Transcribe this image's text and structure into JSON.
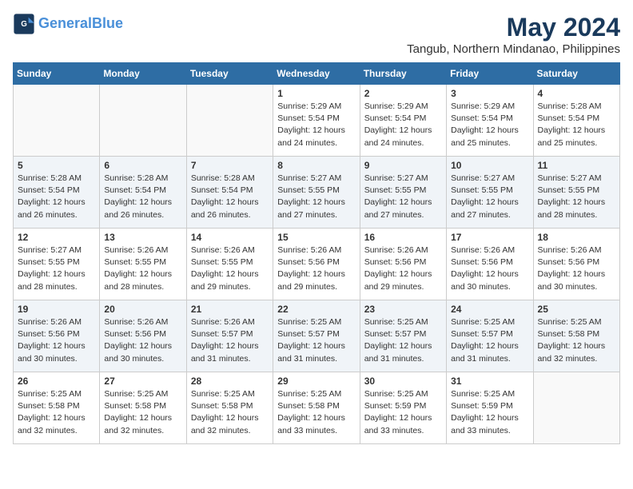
{
  "logo": {
    "line1": "General",
    "line2": "Blue"
  },
  "title": "May 2024",
  "subtitle": "Tangub, Northern Mindanao, Philippines",
  "days_of_week": [
    "Sunday",
    "Monday",
    "Tuesday",
    "Wednesday",
    "Thursday",
    "Friday",
    "Saturday"
  ],
  "weeks": [
    [
      {
        "day": "",
        "content": ""
      },
      {
        "day": "",
        "content": ""
      },
      {
        "day": "",
        "content": ""
      },
      {
        "day": "1",
        "content": "Sunrise: 5:29 AM\nSunset: 5:54 PM\nDaylight: 12 hours\nand 24 minutes."
      },
      {
        "day": "2",
        "content": "Sunrise: 5:29 AM\nSunset: 5:54 PM\nDaylight: 12 hours\nand 24 minutes."
      },
      {
        "day": "3",
        "content": "Sunrise: 5:29 AM\nSunset: 5:54 PM\nDaylight: 12 hours\nand 25 minutes."
      },
      {
        "day": "4",
        "content": "Sunrise: 5:28 AM\nSunset: 5:54 PM\nDaylight: 12 hours\nand 25 minutes."
      }
    ],
    [
      {
        "day": "5",
        "content": "Sunrise: 5:28 AM\nSunset: 5:54 PM\nDaylight: 12 hours\nand 26 minutes."
      },
      {
        "day": "6",
        "content": "Sunrise: 5:28 AM\nSunset: 5:54 PM\nDaylight: 12 hours\nand 26 minutes."
      },
      {
        "day": "7",
        "content": "Sunrise: 5:28 AM\nSunset: 5:54 PM\nDaylight: 12 hours\nand 26 minutes."
      },
      {
        "day": "8",
        "content": "Sunrise: 5:27 AM\nSunset: 5:55 PM\nDaylight: 12 hours\nand 27 minutes."
      },
      {
        "day": "9",
        "content": "Sunrise: 5:27 AM\nSunset: 5:55 PM\nDaylight: 12 hours\nand 27 minutes."
      },
      {
        "day": "10",
        "content": "Sunrise: 5:27 AM\nSunset: 5:55 PM\nDaylight: 12 hours\nand 27 minutes."
      },
      {
        "day": "11",
        "content": "Sunrise: 5:27 AM\nSunset: 5:55 PM\nDaylight: 12 hours\nand 28 minutes."
      }
    ],
    [
      {
        "day": "12",
        "content": "Sunrise: 5:27 AM\nSunset: 5:55 PM\nDaylight: 12 hours\nand 28 minutes."
      },
      {
        "day": "13",
        "content": "Sunrise: 5:26 AM\nSunset: 5:55 PM\nDaylight: 12 hours\nand 28 minutes."
      },
      {
        "day": "14",
        "content": "Sunrise: 5:26 AM\nSunset: 5:55 PM\nDaylight: 12 hours\nand 29 minutes."
      },
      {
        "day": "15",
        "content": "Sunrise: 5:26 AM\nSunset: 5:56 PM\nDaylight: 12 hours\nand 29 minutes."
      },
      {
        "day": "16",
        "content": "Sunrise: 5:26 AM\nSunset: 5:56 PM\nDaylight: 12 hours\nand 29 minutes."
      },
      {
        "day": "17",
        "content": "Sunrise: 5:26 AM\nSunset: 5:56 PM\nDaylight: 12 hours\nand 30 minutes."
      },
      {
        "day": "18",
        "content": "Sunrise: 5:26 AM\nSunset: 5:56 PM\nDaylight: 12 hours\nand 30 minutes."
      }
    ],
    [
      {
        "day": "19",
        "content": "Sunrise: 5:26 AM\nSunset: 5:56 PM\nDaylight: 12 hours\nand 30 minutes."
      },
      {
        "day": "20",
        "content": "Sunrise: 5:26 AM\nSunset: 5:56 PM\nDaylight: 12 hours\nand 30 minutes."
      },
      {
        "day": "21",
        "content": "Sunrise: 5:26 AM\nSunset: 5:57 PM\nDaylight: 12 hours\nand 31 minutes."
      },
      {
        "day": "22",
        "content": "Sunrise: 5:25 AM\nSunset: 5:57 PM\nDaylight: 12 hours\nand 31 minutes."
      },
      {
        "day": "23",
        "content": "Sunrise: 5:25 AM\nSunset: 5:57 PM\nDaylight: 12 hours\nand 31 minutes."
      },
      {
        "day": "24",
        "content": "Sunrise: 5:25 AM\nSunset: 5:57 PM\nDaylight: 12 hours\nand 31 minutes."
      },
      {
        "day": "25",
        "content": "Sunrise: 5:25 AM\nSunset: 5:58 PM\nDaylight: 12 hours\nand 32 minutes."
      }
    ],
    [
      {
        "day": "26",
        "content": "Sunrise: 5:25 AM\nSunset: 5:58 PM\nDaylight: 12 hours\nand 32 minutes."
      },
      {
        "day": "27",
        "content": "Sunrise: 5:25 AM\nSunset: 5:58 PM\nDaylight: 12 hours\nand 32 minutes."
      },
      {
        "day": "28",
        "content": "Sunrise: 5:25 AM\nSunset: 5:58 PM\nDaylight: 12 hours\nand 32 minutes."
      },
      {
        "day": "29",
        "content": "Sunrise: 5:25 AM\nSunset: 5:58 PM\nDaylight: 12 hours\nand 33 minutes."
      },
      {
        "day": "30",
        "content": "Sunrise: 5:25 AM\nSunset: 5:59 PM\nDaylight: 12 hours\nand 33 minutes."
      },
      {
        "day": "31",
        "content": "Sunrise: 5:25 AM\nSunset: 5:59 PM\nDaylight: 12 hours\nand 33 minutes."
      },
      {
        "day": "",
        "content": ""
      }
    ]
  ]
}
